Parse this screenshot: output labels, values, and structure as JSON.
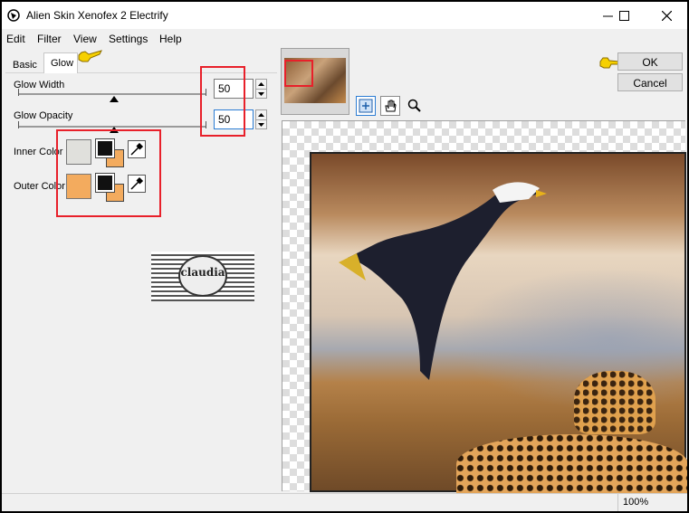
{
  "window": {
    "title": "Alien Skin Xenofex 2 Electrify"
  },
  "menu": [
    "Edit",
    "Filter",
    "View",
    "Settings",
    "Help"
  ],
  "tabs": {
    "basic": "Basic",
    "glow": "Glow",
    "active": "Glow"
  },
  "glow_width": {
    "label": "Glow Width",
    "value": "50"
  },
  "glow_opacity": {
    "label": "Glow Opacity",
    "value": "50"
  },
  "inner_color": {
    "label": "Inner Color",
    "swatch": "#e0e0dc"
  },
  "outer_color": {
    "label": "Outer Color",
    "swatch": "#f3ab5e"
  },
  "buttons": {
    "ok": "OK",
    "cancel": "Cancel"
  },
  "watermark": "claudia",
  "status": {
    "zoom": "100%"
  },
  "colors": {
    "highlight_red": "#e8202a",
    "pointer_yellow": "#f6d000"
  },
  "icons": [
    "app-icon",
    "minimize-icon",
    "maximize-icon",
    "close-icon",
    "pointing-hand-icon",
    "eyedropper-icon",
    "zoom-fit-icon",
    "hand-tool-icon",
    "magnifier-icon"
  ]
}
